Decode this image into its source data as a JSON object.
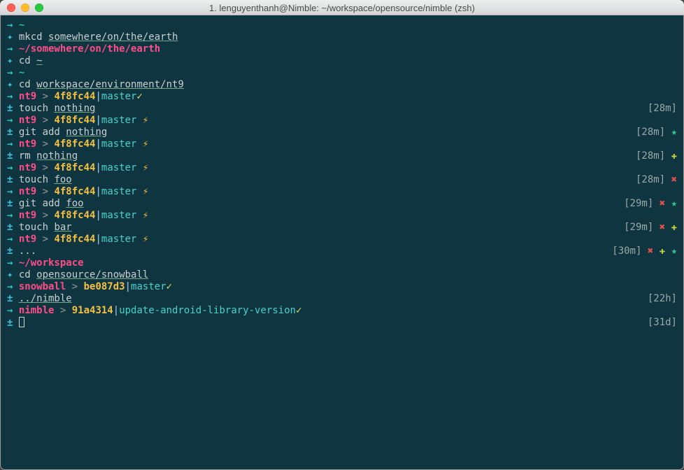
{
  "window": {
    "title": "1. lenguyenthanh@Nimble: ~/workspace/opensource/nimble (zsh)"
  },
  "lines": [
    {
      "left": [
        {
          "t": "→ ",
          "c": "arrow"
        },
        {
          "t": "~",
          "c": "tilde"
        }
      ]
    },
    {
      "left": [
        {
          "t": "✦ ",
          "c": "plus"
        },
        {
          "t": "mkcd ",
          "c": "cmd"
        },
        {
          "t": "somewhere/on/the/earth",
          "c": "arg"
        }
      ]
    },
    {
      "left": [
        {
          "t": "→ ",
          "c": "arrow"
        },
        {
          "t": "~/somewhere/on/the/earth",
          "c": "pink"
        }
      ]
    },
    {
      "left": [
        {
          "t": "✦ ",
          "c": "plus"
        },
        {
          "t": "cd ",
          "c": "cmd"
        },
        {
          "t": "~",
          "c": "arg"
        }
      ]
    },
    {
      "left": [
        {
          "t": "→ ",
          "c": "arrow"
        },
        {
          "t": "~",
          "c": "tilde"
        }
      ]
    },
    {
      "left": [
        {
          "t": "✦ ",
          "c": "plus"
        },
        {
          "t": "cd ",
          "c": "cmd"
        },
        {
          "t": "workspace/environment/nt9",
          "c": "arg"
        }
      ]
    },
    {
      "left": [
        {
          "t": "→ ",
          "c": "arrow"
        },
        {
          "t": "nt9",
          "c": "pink"
        },
        {
          "t": " > ",
          "c": "caret"
        },
        {
          "t": "4f8fc44",
          "c": "hash"
        },
        {
          "t": "|",
          "c": "pipe"
        },
        {
          "t": "master",
          "c": "branch"
        },
        {
          "t": "✓",
          "c": "check"
        }
      ]
    },
    {
      "left": [
        {
          "t": "± ",
          "c": "plus"
        },
        {
          "t": "touch ",
          "c": "cmd"
        },
        {
          "t": "nothing",
          "c": "arg"
        }
      ],
      "right": [
        {
          "t": "[28m]",
          "c": "time"
        }
      ]
    },
    {
      "left": [
        {
          "t": "→ ",
          "c": "arrow"
        },
        {
          "t": "nt9",
          "c": "pink"
        },
        {
          "t": " > ",
          "c": "caret"
        },
        {
          "t": "4f8fc44",
          "c": "hash"
        },
        {
          "t": "|",
          "c": "pipe"
        },
        {
          "t": "master",
          "c": "branch"
        },
        {
          "t": " ⚡",
          "c": "bolt"
        }
      ]
    },
    {
      "left": [
        {
          "t": "± ",
          "c": "plus"
        },
        {
          "t": "git ",
          "c": "cmd"
        },
        {
          "t": "add ",
          "c": "cmd"
        },
        {
          "t": "nothing",
          "c": "arg"
        }
      ],
      "right": [
        {
          "t": "[28m] ",
          "c": "time"
        },
        {
          "t": "★",
          "c": "star"
        }
      ]
    },
    {
      "left": [
        {
          "t": "→ ",
          "c": "arrow"
        },
        {
          "t": "nt9",
          "c": "pink"
        },
        {
          "t": " > ",
          "c": "caret"
        },
        {
          "t": "4f8fc44",
          "c": "hash"
        },
        {
          "t": "|",
          "c": "pipe"
        },
        {
          "t": "master",
          "c": "branch"
        },
        {
          "t": " ⚡",
          "c": "bolt"
        }
      ]
    },
    {
      "left": [
        {
          "t": "± ",
          "c": "plus"
        },
        {
          "t": "rm ",
          "c": "cmd"
        },
        {
          "t": "nothing",
          "c": "arg"
        }
      ],
      "right": [
        {
          "t": "[28m] ",
          "c": "time"
        },
        {
          "t": "✚",
          "c": "plusG"
        }
      ]
    },
    {
      "left": [
        {
          "t": "→ ",
          "c": "arrow"
        },
        {
          "t": "nt9",
          "c": "pink"
        },
        {
          "t": " > ",
          "c": "caret"
        },
        {
          "t": "4f8fc44",
          "c": "hash"
        },
        {
          "t": "|",
          "c": "pipe"
        },
        {
          "t": "master",
          "c": "branch"
        },
        {
          "t": " ⚡",
          "c": "bolt"
        }
      ]
    },
    {
      "left": [
        {
          "t": "± ",
          "c": "plus"
        },
        {
          "t": "touch ",
          "c": "cmd"
        },
        {
          "t": "foo",
          "c": "arg"
        }
      ],
      "right": [
        {
          "t": "[28m] ",
          "c": "time"
        },
        {
          "t": "✖",
          "c": "xmark"
        }
      ]
    },
    {
      "left": [
        {
          "t": "→ ",
          "c": "arrow"
        },
        {
          "t": "nt9",
          "c": "pink"
        },
        {
          "t": " > ",
          "c": "caret"
        },
        {
          "t": "4f8fc44",
          "c": "hash"
        },
        {
          "t": "|",
          "c": "pipe"
        },
        {
          "t": "master",
          "c": "branch"
        },
        {
          "t": " ⚡",
          "c": "bolt"
        }
      ]
    },
    {
      "left": [
        {
          "t": "± ",
          "c": "plus"
        },
        {
          "t": "git ",
          "c": "cmd"
        },
        {
          "t": "add ",
          "c": "cmd"
        },
        {
          "t": "foo",
          "c": "arg"
        }
      ],
      "right": [
        {
          "t": "[29m] ",
          "c": "time"
        },
        {
          "t": "✖ ",
          "c": "xmark"
        },
        {
          "t": "★",
          "c": "star"
        }
      ]
    },
    {
      "left": [
        {
          "t": "→ ",
          "c": "arrow"
        },
        {
          "t": "nt9",
          "c": "pink"
        },
        {
          "t": " > ",
          "c": "caret"
        },
        {
          "t": "4f8fc44",
          "c": "hash"
        },
        {
          "t": "|",
          "c": "pipe"
        },
        {
          "t": "master",
          "c": "branch"
        },
        {
          "t": " ⚡",
          "c": "bolt"
        }
      ]
    },
    {
      "left": [
        {
          "t": "± ",
          "c": "plus"
        },
        {
          "t": "touch ",
          "c": "cmd"
        },
        {
          "t": "bar",
          "c": "arg"
        }
      ],
      "right": [
        {
          "t": "[29m] ",
          "c": "time"
        },
        {
          "t": "✖ ",
          "c": "xmark"
        },
        {
          "t": "✚",
          "c": "plusG"
        }
      ]
    },
    {
      "left": [
        {
          "t": "→ ",
          "c": "arrow"
        },
        {
          "t": "nt9",
          "c": "pink"
        },
        {
          "t": " > ",
          "c": "caret"
        },
        {
          "t": "4f8fc44",
          "c": "hash"
        },
        {
          "t": "|",
          "c": "pipe"
        },
        {
          "t": "master",
          "c": "branch"
        },
        {
          "t": " ⚡",
          "c": "bolt"
        }
      ]
    },
    {
      "left": [
        {
          "t": "± ",
          "c": "plus"
        },
        {
          "t": "...",
          "c": "cmd"
        }
      ],
      "right": [
        {
          "t": "[30m] ",
          "c": "time"
        },
        {
          "t": "✖ ",
          "c": "xmark"
        },
        {
          "t": "✚ ",
          "c": "plusG"
        },
        {
          "t": "★",
          "c": "star"
        }
      ]
    },
    {
      "left": [
        {
          "t": "→ ",
          "c": "arrow"
        },
        {
          "t": "~/workspace",
          "c": "pink"
        }
      ]
    },
    {
      "left": [
        {
          "t": "✦ ",
          "c": "plus"
        },
        {
          "t": "cd ",
          "c": "cmd"
        },
        {
          "t": "opensource/snowball",
          "c": "arg"
        }
      ]
    },
    {
      "left": [
        {
          "t": "→ ",
          "c": "arrow"
        },
        {
          "t": "snowball",
          "c": "pink"
        },
        {
          "t": " > ",
          "c": "caret"
        },
        {
          "t": "be087d3",
          "c": "hash"
        },
        {
          "t": "|",
          "c": "pipe"
        },
        {
          "t": "master",
          "c": "branch"
        },
        {
          "t": "✓",
          "c": "check"
        }
      ]
    },
    {
      "left": [
        {
          "t": "± ",
          "c": "plus"
        },
        {
          "t": "../nimble",
          "c": "arg"
        }
      ],
      "right": [
        {
          "t": "[22h]",
          "c": "time"
        }
      ]
    },
    {
      "left": [
        {
          "t": "→ ",
          "c": "arrow"
        },
        {
          "t": "nimble",
          "c": "pink"
        },
        {
          "t": " > ",
          "c": "caret"
        },
        {
          "t": "91a4314",
          "c": "hash"
        },
        {
          "t": "|",
          "c": "pipe"
        },
        {
          "t": "update-android-library-version",
          "c": "branch"
        },
        {
          "t": "✓",
          "c": "check"
        }
      ]
    },
    {
      "left": [
        {
          "t": "± ",
          "c": "plus"
        },
        {
          "t": "CURSOR",
          "c": "cursor"
        }
      ],
      "right": [
        {
          "t": "[31d]",
          "c": "time"
        }
      ]
    }
  ]
}
